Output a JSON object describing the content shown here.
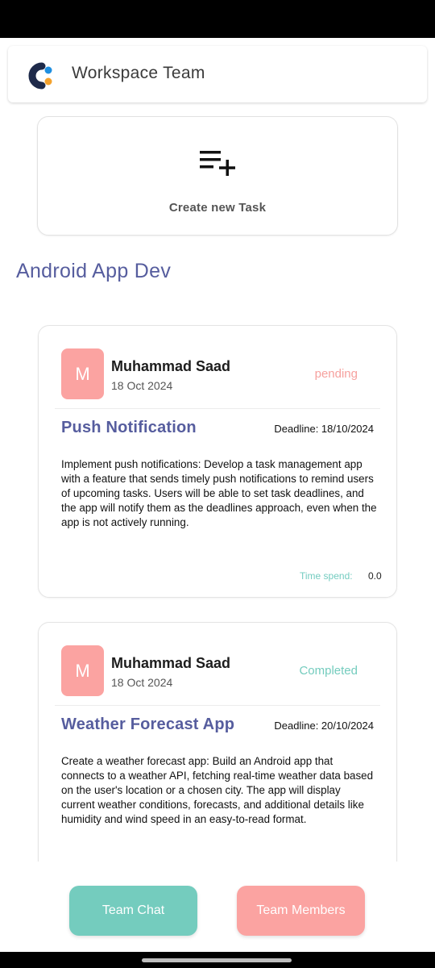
{
  "header": {
    "title": "Workspace Team",
    "logo_icon": "workspace-logo-icon"
  },
  "create_task": {
    "label": "Create new Task",
    "icon": "playlist-add-icon"
  },
  "project": {
    "title": "Android App Dev"
  },
  "tasks": [
    {
      "avatar_initial": "M",
      "user_name": "Muhammad Saad",
      "date": "18 Oct 2024",
      "status": "pending",
      "status_color": "#f6a19e",
      "title": "Push Notification",
      "deadline": "Deadline: 18/10/2024",
      "description": "Implement push notifications: Develop a task management app with a feature that sends timely push notifications to remind users of upcoming tasks. Users will be able to set task deadlines, and the app will notify them as the deadlines approach, even when the app is not actively running.",
      "time_label": "Time spend:",
      "time_value": "0.0"
    },
    {
      "avatar_initial": "M",
      "user_name": "Muhammad Saad",
      "date": "18 Oct 2024",
      "status": "Completed",
      "status_color": "#74ccbe",
      "title": "Weather Forecast App",
      "deadline": "Deadline: 20/10/2024",
      "description": "Create a weather forecast app: Build an Android app that connects to a weather API, fetching real-time weather data based on the user's location or a chosen city. The app will display current weather conditions, forecasts, and additional details like humidity and wind speed in an easy-to-read format."
    }
  ],
  "buttons": {
    "team_chat": "Team Chat",
    "team_members": "Team Members"
  },
  "colors": {
    "accent_purple": "#565d9e",
    "teal": "#74ccbe",
    "pink": "#fba3a1",
    "logo_blue": "#1f6fc2",
    "logo_orange": "#f4a22d"
  }
}
